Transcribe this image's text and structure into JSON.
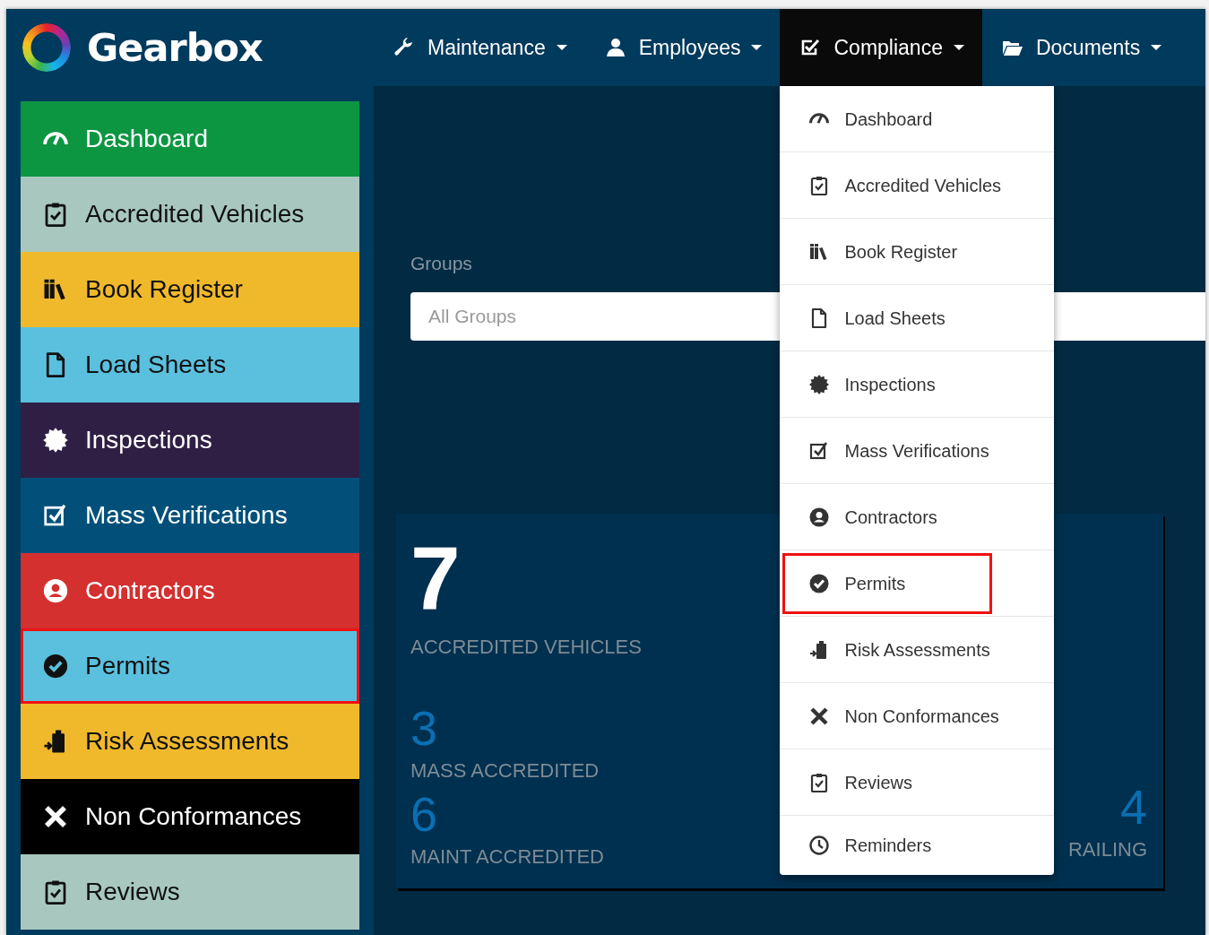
{
  "brand": {
    "name": "Gearbox"
  },
  "nav": [
    {
      "label": "Maintenance",
      "selected": false
    },
    {
      "label": "Employees",
      "selected": false
    },
    {
      "label": "Compliance",
      "selected": true,
      "menu": [
        {
          "label": "Dashboard",
          "highlighted": false
        },
        {
          "label": "Accredited Vehicles",
          "highlighted": false
        },
        {
          "label": "Book Register",
          "highlighted": false
        },
        {
          "label": "Load Sheets",
          "highlighted": false
        },
        {
          "label": "Inspections",
          "highlighted": false
        },
        {
          "label": "Mass Verifications",
          "highlighted": false
        },
        {
          "label": "Contractors",
          "highlighted": false
        },
        {
          "label": "Permits",
          "highlighted": true
        },
        {
          "label": "Risk Assessments",
          "highlighted": false
        },
        {
          "label": "Non Conformances",
          "highlighted": false
        },
        {
          "label": "Reviews",
          "highlighted": false
        },
        {
          "label": "Reminders",
          "highlighted": false
        }
      ]
    },
    {
      "label": "Documents",
      "selected": false
    }
  ],
  "sidebar": {
    "items": [
      {
        "label": "Dashboard",
        "color": "#0d9642",
        "highlighted": false
      },
      {
        "label": "Accredited Vehicles",
        "color": "#a8c8bf",
        "highlighted": false
      },
      {
        "label": "Book Register",
        "color": "#f0b92c",
        "highlighted": false
      },
      {
        "label": "Load Sheets",
        "color": "#5bc0de",
        "highlighted": false
      },
      {
        "label": "Inspections",
        "color": "#2f1f44",
        "highlighted": false
      },
      {
        "label": "Mass Verifications",
        "color": "#02507a",
        "highlighted": false
      },
      {
        "label": "Contractors",
        "color": "#d3302f",
        "highlighted": false
      },
      {
        "label": "Permits",
        "color": "#5bc0de",
        "highlighted": true
      },
      {
        "label": "Risk Assessments",
        "color": "#f0b92c",
        "highlighted": false
      },
      {
        "label": "Non Conformances",
        "color": "#000000",
        "highlighted": false
      },
      {
        "label": "Reviews",
        "color": "#a8c8bf",
        "highlighted": false
      }
    ]
  },
  "groups_filter": {
    "label": "Groups",
    "placeholder": "All Groups"
  },
  "stats_card": {
    "primary": {
      "value": "7",
      "label": "ACCREDITED VEHICLES"
    },
    "secondary": [
      {
        "value": "3",
        "label": "MASS ACCREDITED"
      },
      {
        "value": "6",
        "label": "MAINT ACCREDITED"
      }
    ],
    "side": {
      "value": "4",
      "label": "RAILING"
    }
  }
}
